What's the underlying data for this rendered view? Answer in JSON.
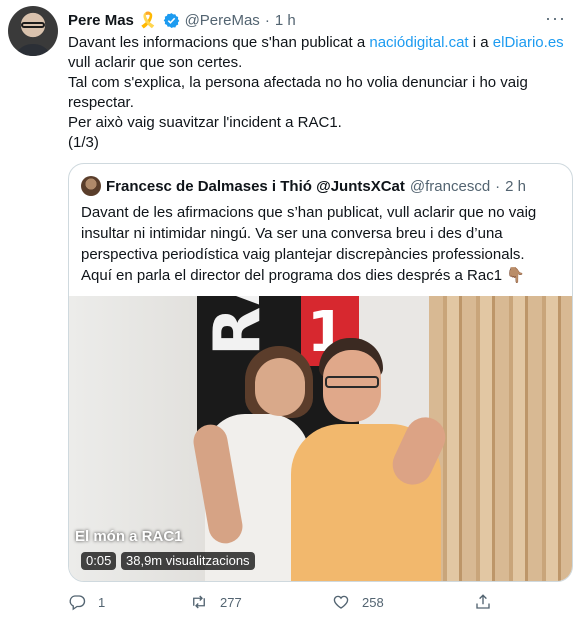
{
  "tweet": {
    "author_name": "Pere Mas",
    "ribbon": "🎗️",
    "handle": "@PereMas",
    "separator": "·",
    "time": "1 h",
    "more": "···",
    "text_lines": {
      "l1_a": "Davant les informacions que s'han publicat a ",
      "l1_link1": "naciódigital.cat",
      "l1_b": " i a ",
      "l1_link2": "elDiario.es",
      "l2": "vull aclarir que son certes.",
      "l3": "Tal com s'explica, la persona afectada no ho volia denunciar i ho vaig",
      "l4": "respectar.",
      "l5": "Per això vaig suavitzar l'incident a RAC1.",
      "l6": "(1/3)"
    }
  },
  "quote": {
    "author_name": "Francesc de Dalmases i Thió @JuntsXCat",
    "handle": "@francescd",
    "separator": "·",
    "time": "2 h",
    "text_lines": {
      "l1": "Davant de les afirmacions que s’han publicat, vull aclarir que no vaig",
      "l2": "insultar ni intimidar ningú. Va ser una conversa breu i des d’una",
      "l3": "perspectiva periodística vaig plantejar discrepàncies professionals.",
      "l4": "Aquí en parla el director del programa dos dies després a Rac1 👇🏽"
    },
    "media": {
      "logo_text": "RAC",
      "logo_number": "1",
      "caption": "El món a RAC1",
      "duration": "0:05",
      "views": "38,9m visualitzacions"
    }
  },
  "actions": {
    "reply_count": "1",
    "retweet_count": "277",
    "like_count": "258"
  },
  "colors": {
    "link": "#1d9bf0",
    "muted": "#536471",
    "verified": "#1d9bf0",
    "border": "#cfd9de"
  }
}
